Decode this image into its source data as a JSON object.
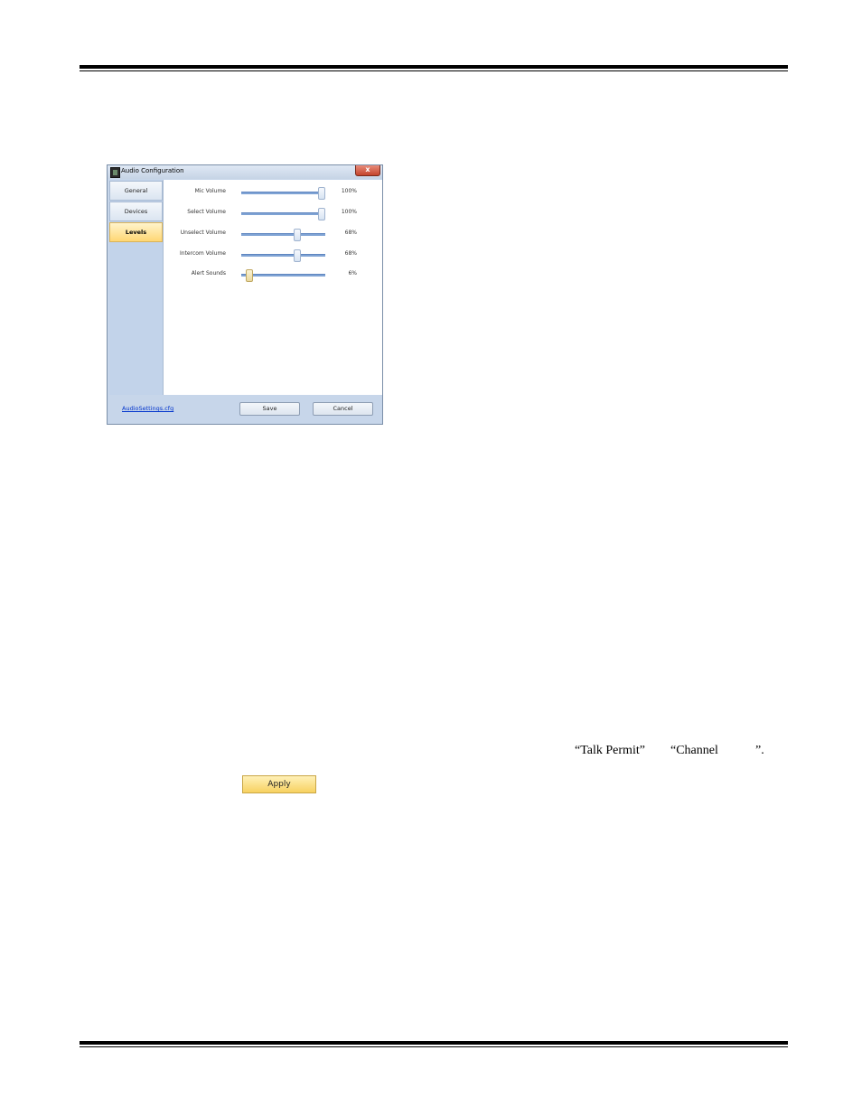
{
  "dialog": {
    "title": "Audio Configuration",
    "close_glyph": "x",
    "nav": [
      {
        "label": "General",
        "active": false
      },
      {
        "label": "Devices",
        "active": false
      },
      {
        "label": "Levels",
        "active": true
      }
    ],
    "sliders": [
      {
        "label": "Mic Volume",
        "value_text": "100%",
        "value": 100
      },
      {
        "label": "Select Volume",
        "value_text": "100%",
        "value": 100
      },
      {
        "label": "Unselect Volume",
        "value_text": "68%",
        "value": 68
      },
      {
        "label": "Intercom Volume",
        "value_text": "68%",
        "value": 68
      },
      {
        "label": "Alert Sounds",
        "value_text": "6%",
        "value": 6
      }
    ],
    "file_link": "AudioSettings.cfg",
    "save_label": "Save",
    "cancel_label": "Cancel",
    "accent_color": "#ffd774"
  },
  "body": {
    "quote_talk_permit": "“Talk Permit”",
    "quote_channel": "“Channel",
    "quote_close": "”.",
    "apply_label": "Apply"
  }
}
